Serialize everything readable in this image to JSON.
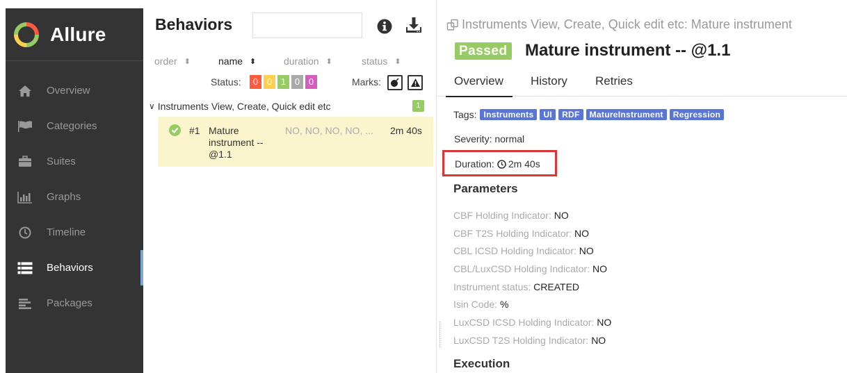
{
  "brand": {
    "name": "Allure"
  },
  "sidebar": {
    "items": [
      {
        "label": "Overview",
        "icon": "home-icon"
      },
      {
        "label": "Categories",
        "icon": "flag-icon"
      },
      {
        "label": "Suites",
        "icon": "briefcase-icon"
      },
      {
        "label": "Graphs",
        "icon": "bar-chart-icon"
      },
      {
        "label": "Timeline",
        "icon": "clock-icon"
      },
      {
        "label": "Behaviors",
        "icon": "list-icon",
        "active": true
      },
      {
        "label": "Packages",
        "icon": "packages-icon"
      }
    ]
  },
  "tree": {
    "title": "Behaviors",
    "search_value": "",
    "sort": {
      "order": "order",
      "name": "name",
      "duration": "duration",
      "status": "status"
    },
    "status_filter": {
      "label": "Status:",
      "counts": [
        "0",
        "0",
        "1",
        "0",
        "0"
      ]
    },
    "marks_label": "Marks:",
    "group": {
      "label": "Instruments View, Create, Quick edit etc",
      "count": "1"
    },
    "test": {
      "num": "#1",
      "name": "Mature instrument -- @1.1",
      "params": "NO, NO, NO, NO, ...",
      "duration": "2m 40s"
    }
  },
  "detail": {
    "breadcrumb": "Instruments View, Create, Quick edit etc: Mature instrument",
    "status": "Passed",
    "title": "Mature instrument -- @1.1",
    "tabs": [
      "Overview",
      "History",
      "Retries"
    ],
    "tags_label": "Tags:",
    "tags": [
      "Instruments",
      "UI",
      "RDF",
      "MatureInstrument",
      "Regression"
    ],
    "severity": "Severity: normal",
    "duration_label": "Duration:",
    "duration_value": "2m 40s",
    "parameters_heading": "Parameters",
    "parameters": [
      {
        "name": "CBF Holding Indicator:",
        "value": "NO"
      },
      {
        "name": "CBF T2S Holding Indicator:",
        "value": "NO"
      },
      {
        "name": "CBL ICSD Holding Indicator:",
        "value": "NO"
      },
      {
        "name": "CBL/LuxCSD Holding Indicator:",
        "value": "NO"
      },
      {
        "name": "Instrument status:",
        "value": "CREATED"
      },
      {
        "name": "Isin Code:",
        "value": "%"
      },
      {
        "name": "LuxCSD ICSD Holding Indicator:",
        "value": "NO"
      },
      {
        "name": "LuxCSD T2S Holding Indicator:",
        "value": "NO"
      }
    ],
    "execution_heading": "Execution"
  },
  "colors": {
    "sidebar_bg": "#343434",
    "passed": "#97cc64",
    "failed": "#fd5a3e",
    "broken": "#ffd050",
    "skipped": "#aaaaaa",
    "unknown": "#d35ebe",
    "tag": "#5976d6",
    "highlight_box": "#d93636"
  }
}
